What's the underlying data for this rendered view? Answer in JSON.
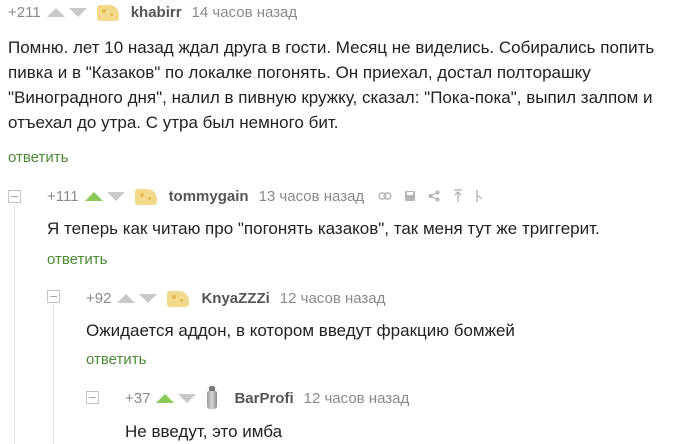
{
  "comments": [
    {
      "rating": "+211",
      "author": "khabirr",
      "time": "14 часов назад",
      "text": "Помню. лет 10 назад ждал друга в гости. Месяц не виделись. Собирались попить пивка и в \"Казаков\" по локалке погонять. Он приехал, достал полторашку \"Виноградного дня\", налил в пивную кружку, сказал: \"Пока-пока\", выпил залпом и отъехал до утра. С утра был немного бит.",
      "reply_label": "ответить"
    },
    {
      "rating": "+111",
      "author": "tommygain",
      "time": "13 часов назад",
      "text": "Я теперь как читаю про \"погонять казаков\", так меня тут же триггерит.",
      "reply_label": "ответить"
    },
    {
      "rating": "+92",
      "author": "KnyaZZZi",
      "time": "12 часов назад",
      "text": "Ожидается аддон, в котором введут фракцию бомжей",
      "reply_label": "ответить"
    },
    {
      "rating": "+37",
      "author": "BarProfi",
      "time": "12 часов назад",
      "text": "Не введут, это имба"
    }
  ],
  "colors": {
    "upvote_active": "#8ac858",
    "reply_link": "#4b8a34",
    "meta_gray": "#8a8a8a"
  }
}
